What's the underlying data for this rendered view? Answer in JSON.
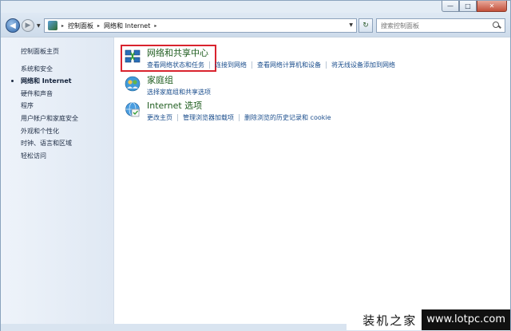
{
  "window": {
    "minimize_glyph": "—",
    "maximize_glyph": "□",
    "close_glyph": "✕"
  },
  "nav": {
    "back_glyph": "◀",
    "forward_glyph": "▶",
    "dropdown_glyph": "▼",
    "breadcrumb_sep": "▸",
    "breadcrumbs": [
      "控制面板",
      "网络和 Internet"
    ],
    "refresh_glyph": "↻",
    "search_placeholder": "搜索控制面板"
  },
  "sidebar": {
    "home": "控制面板主页",
    "items": [
      {
        "label": "系统和安全",
        "active": false
      },
      {
        "label": "网络和 Internet",
        "active": true
      },
      {
        "label": "硬件和声音",
        "active": false
      },
      {
        "label": "程序",
        "active": false
      },
      {
        "label": "用户帐户和家庭安全",
        "active": false
      },
      {
        "label": "外观和个性化",
        "active": false
      },
      {
        "label": "时钟、语言和区域",
        "active": false
      },
      {
        "label": "轻松访问",
        "active": false
      }
    ]
  },
  "categories": [
    {
      "title": "网络和共享中心",
      "icon": "network-sharing-icon",
      "links": [
        "查看网络状态和任务",
        "连接到网络",
        "查看网络计算机和设备",
        "将无线设备添加到网络"
      ]
    },
    {
      "title": "家庭组",
      "icon": "homegroup-icon",
      "links": [
        "选择家庭组和共享选项"
      ]
    },
    {
      "title": "Internet 选项",
      "icon": "internet-options-icon",
      "links": [
        "更改主页",
        "管理浏览器加载项",
        "删除浏览的历史记录和 cookie"
      ]
    }
  ],
  "watermark": {
    "cn": "装机之家",
    "url": "www.lotpc.com"
  },
  "colors": {
    "accent_link": "#1a4d8c",
    "title_green": "#1e5c1e",
    "highlight_red": "#d9232e"
  }
}
